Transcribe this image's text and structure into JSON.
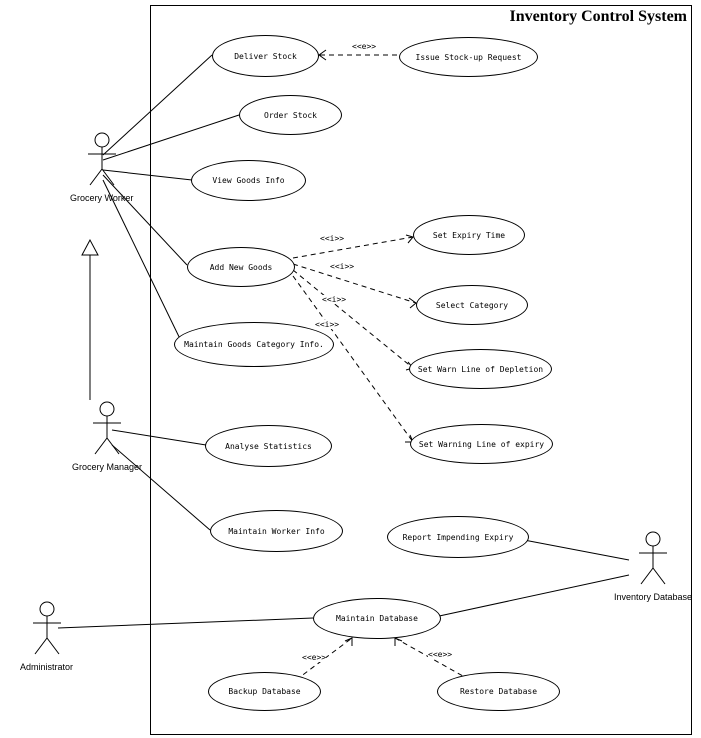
{
  "diagram": {
    "title": "Inventory Control System",
    "actors": {
      "grocery_worker": "Grocery Worker",
      "grocery_manager": "Grocery Manager",
      "administrator": "Administrator",
      "inventory_database": "Inventory Database"
    },
    "usecases": {
      "deliver_stock": "Deliver Stock",
      "issue_stockup": "Issue Stock-up Request",
      "order_stock": "Order Stock",
      "view_goods_info": "View Goods Info",
      "add_new_goods": "Add New Goods",
      "maintain_goods_cat": "Maintain Goods Category Info.",
      "set_expiry_time": "Set Expiry Time",
      "select_category": "Select Category",
      "set_warn_depletion": "Set Warn Line of Depletion",
      "set_warn_expiry": "Set Warning Line of expiry",
      "analyse_stats": "Analyse Statistics",
      "maintain_worker_info": "Maintain Worker Info",
      "report_expiry": "Report Impending Expiry",
      "maintain_db": "Maintain Database",
      "backup_db": "Backup Database",
      "restore_db": "Restore Database"
    },
    "stereotypes": {
      "extend": "<<e>>",
      "include": "<<i>>"
    }
  },
  "chart_data": {
    "type": "uml-use-case-diagram",
    "system": "Inventory Control System",
    "actors": [
      "Grocery Worker",
      "Grocery Manager",
      "Administrator",
      "Inventory Database"
    ],
    "use_cases": [
      "Deliver Stock",
      "Issue Stock-up Request",
      "Order Stock",
      "View Goods Info",
      "Add New Goods",
      "Maintain Goods Category Info.",
      "Set Expiry Time",
      "Select Category",
      "Set Warn Line of Depletion",
      "Set Warning Line of expiry",
      "Analyse Statistics",
      "Maintain Worker Info",
      "Report Impending Expiry",
      "Maintain Database",
      "Backup Database",
      "Restore Database"
    ],
    "generalizations": [
      {
        "child": "Grocery Manager",
        "parent": "Grocery Worker"
      }
    ],
    "associations": [
      {
        "actor": "Grocery Worker",
        "usecase": "Deliver Stock"
      },
      {
        "actor": "Grocery Worker",
        "usecase": "Order Stock"
      },
      {
        "actor": "Grocery Worker",
        "usecase": "View Goods Info"
      },
      {
        "actor": "Grocery Worker",
        "usecase": "Add New Goods"
      },
      {
        "actor": "Grocery Worker",
        "usecase": "Maintain Goods Category Info."
      },
      {
        "actor": "Grocery Manager",
        "usecase": "Analyse Statistics"
      },
      {
        "actor": "Grocery Manager",
        "usecase": "Maintain Worker Info"
      },
      {
        "actor": "Administrator",
        "usecase": "Maintain Database"
      },
      {
        "actor": "Inventory Database",
        "usecase": "Report Impending Expiry"
      },
      {
        "actor": "Inventory Database",
        "usecase": "Maintain Database"
      }
    ],
    "extends": [
      {
        "extension": "Issue Stock-up Request",
        "base": "Deliver Stock"
      },
      {
        "extension": "Backup Database",
        "base": "Maintain Database"
      },
      {
        "extension": "Restore Database",
        "base": "Maintain Database"
      }
    ],
    "includes": [
      {
        "base": "Add New Goods",
        "inclusion": "Set Expiry Time"
      },
      {
        "base": "Add New Goods",
        "inclusion": "Select Category"
      },
      {
        "base": "Add New Goods",
        "inclusion": "Set Warn Line of Depletion"
      },
      {
        "base": "Add New Goods",
        "inclusion": "Set Warning Line of expiry"
      }
    ]
  }
}
